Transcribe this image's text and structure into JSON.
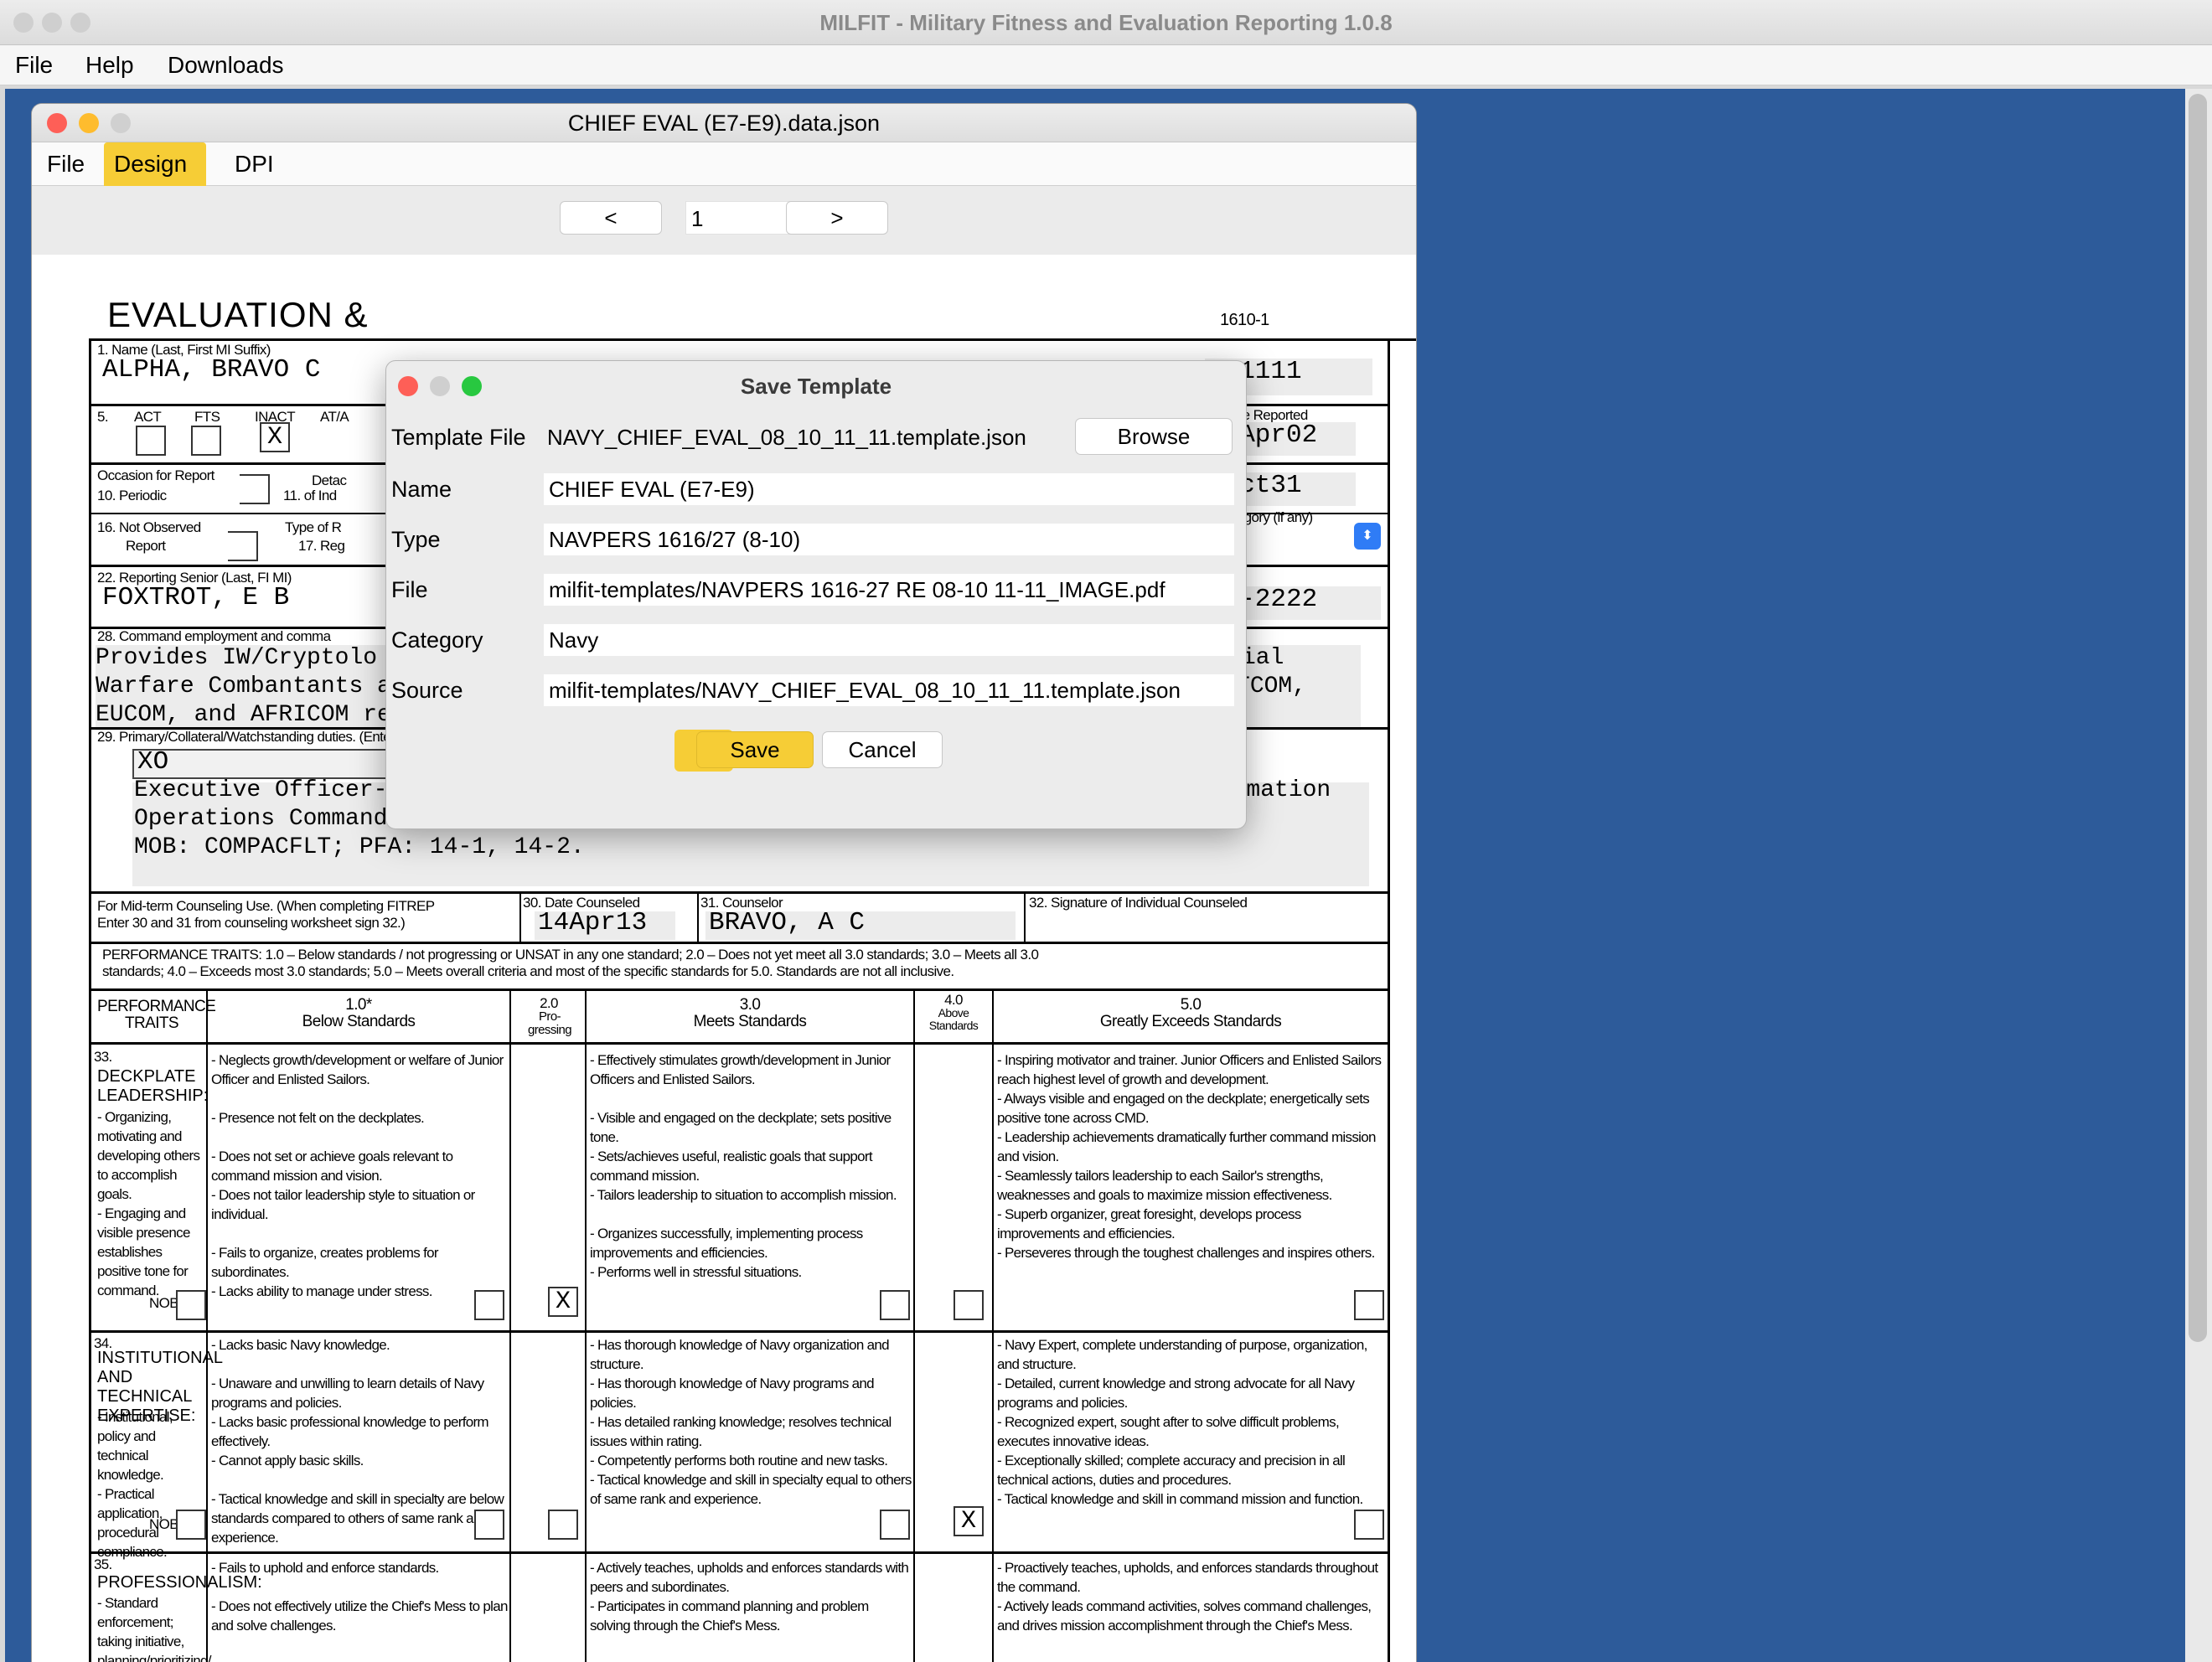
{
  "app": {
    "title": "MILFIT - Military Fitness and Evaluation Reporting 1.0.8",
    "menu": [
      "File",
      "Help",
      "Downloads"
    ]
  },
  "doc": {
    "title": "CHIEF EVAL (E7-E9).data.json",
    "menu": [
      "File",
      "Design",
      "DPI"
    ],
    "prev_label": "<",
    "next_label": ">",
    "page_number": "1"
  },
  "form": {
    "heading": "EVALUATION &",
    "form_number": "1610-1",
    "labels": {
      "name": "1. Name      (Last, First MI Suffix)",
      "block5": "5.",
      "act": "ACT",
      "fts": "FTS",
      "inact": "INACT",
      "atadsw": "AT/A",
      "date_reported": "Date Reported",
      "occasion": "Occasion for Report",
      "periodic": "10. Periodic",
      "detach": "Detac",
      "detach2": "11.  of Ind",
      "not_observed": "16. Not Observed",
      "report": "Report",
      "type_of": "Type of R",
      "regular": "17.  Reg",
      "subcategory": "bcategory (if any)",
      "reporting_senior": "22. Reporting Senior  (Last, FI MI)",
      "command_employment": "28. Command employment and comma",
      "duties": "29. Primary/Collateral/Watchstanding duties.  (Enter Primary duty abbreviation in box.)",
      "midterm": "For Mid-term Counseling Use.  (When completing FITREP",
      "midterm2": "Enter 30 and 31 from counseling worksheet sign 32.)",
      "date_counseled": "30.  Date Counseled",
      "counselor": "31.  Counselor",
      "signature": "32.  Signature of Individual Counseled",
      "perf_note1": "PERFORMANCE TRAITS:  1.0 – Below standards / not progressing or UNSAT in any one standard;   2.0 – Does not yet meet all 3.0 standards;   3.0 – Meets all 3.0",
      "perf_note2": "standards;   4.0 – Exceeds most 3.0 standards;   5.0 – Meets overall criteria and most of the specific standards for 5.0.  Standards are not all inclusive."
    },
    "values": {
      "name": "ALPHA, BRAVO C",
      "ssn": "1-1111",
      "inact_mark": "X",
      "date_reported": "14Apr02",
      "to_date": "40ct31",
      "reporting_senior": "FOXTROT, E B",
      "rs_ssn": "22-2222",
      "command_line1": "Provides IW/Cryptolo",
      "command_line1_end": "ial",
      "command_line2": "Warfare Combantants and AAA/BBB Georgia. Reach back/extended staff support to CENTCOM,",
      "command_line3": "EUCOM, and AFRICOM requirements.",
      "duty_abbrev": "XO",
      "duties_line1": "Executive Officer-8; Lead administration and operations of 29-Sailor Navy Information",
      "duties_line2": "Operations Command.",
      "duties_line3": "MOB: COMPACFLT; PFA: 14-1, 14-2.",
      "date_counseled": "14Apr13",
      "counselor": "BRAVO, A C"
    },
    "headers": {
      "traits": "PERFORMANCE TRAITS",
      "h1": "1.0*",
      "h1b": "Below Standards",
      "h2": "2.0",
      "h2b": "Pro-gressing",
      "h3": "3.0",
      "h3b": "Meets Standards",
      "h4": "4.0",
      "h4b": "Above Standards",
      "h5": "5.0",
      "h5b": "Greatly Exceeds Standards"
    },
    "traits": [
      {
        "num": "33.",
        "name": "DECKPLATE LEADERSHIP:",
        "desc": "- Organizing, motivating and developing others to accomplish goals.\n- Engaging and visible presence establishes positive tone for command.",
        "nob": "NOB",
        "below": "- Neglects growth/development or welfare of Junior Officer and Enlisted Sailors.\n\n- Presence not felt on the deckplates.\n\n- Does not set or achieve goals relevant to command mission and vision.\n- Does not tailor leadership style to situation or individual.\n\n- Fails to organize, creates problems for subordinates.\n- Lacks ability to manage under stress.",
        "meets": "- Effectively stimulates growth/development in Junior Officers and Enlisted Sailors.\n\n- Visible and engaged on the deckplate; sets positive tone.\n- Sets/achieves useful, realistic goals that support command mission.\n- Tailors leadership to situation to accomplish mission.\n\n- Organizes successfully, implementing process improvements and efficiencies.\n- Performs well in stressful situations.",
        "greatly": "- Inspiring motivator and trainer.  Junior Officers and Enlisted Sailors reach highest level of growth and development.\n- Always visible and engaged on the deckplate; energetically sets positive tone across CMD.\n- Leadership achievements dramatically further command mission and vision.\n- Seamlessly tailors leadership to each Sailor's strengths, weaknesses and goals to maximize mission effectiveness.\n- Superb organizer, great foresight, develops process improvements and efficiencies.\n- Perseveres through the toughest challenges and inspires others.",
        "marks": [
          "",
          "",
          "X",
          "",
          "",
          ""
        ]
      },
      {
        "num": "34.",
        "name": "INSTITUTIONAL AND TECHNICAL EXPERTISE:",
        "desc": "- Institutional, policy and technical knowledge.\n- Practical application, procedural compliance.",
        "nob": "NOB",
        "below": "- Lacks basic Navy knowledge.\n\n- Unaware and unwilling to learn details of Navy programs and policies.\n- Lacks basic professional knowledge to perform effectively.\n- Cannot apply basic skills.\n\n- Tactical knowledge and skill in specialty are below standards compared to others of same rank and experience.",
        "meets": "- Has thorough knowledge of Navy organization and structure.\n- Has thorough knowledge of Navy programs and policies.\n- Has detailed ranking knowledge; resolves technical issues within rating.\n- Competently performs both routine and new tasks.\n- Tactical knowledge and skill in specialty equal to others of same rank and experience.",
        "greatly": "- Navy Expert, complete understanding of purpose, organization, and structure.\n- Detailed, current knowledge and strong advocate for all Navy programs and policies.\n- Recognized expert, sought after to solve difficult problems, executes innovative ideas.\n- Exceptionally skilled; complete accuracy and precision in all technical actions, duties and procedures.\n- Tactical knowledge and skill in command mission and function.",
        "marks": [
          "",
          "",
          "",
          "",
          "X",
          ""
        ]
      },
      {
        "num": "35.",
        "name": "PROFESSIONALISM:",
        "desc": "- Standard enforcement; taking initiative, planning/prioritizing/",
        "below": "- Fails to uphold and enforce standards.\n\n- Does not effectively utilize the Chief's Mess to plan and solve challenges.",
        "meets": "- Actively teaches, upholds and enforces standards with peers and subordinates.\n- Participates in command planning and problem solving through the Chief's Mess.",
        "greatly": "- Proactively teaches, upholds, and enforces standards throughout the command.\n- Actively leads command activities, solves command challenges, and drives mission accomplishment through the Chief's Mess."
      }
    ]
  },
  "dialog": {
    "title": "Save Template",
    "template_file_label": "Template File",
    "template_file_value": "NAVY_CHIEF_EVAL_08_10_11_11.template.json",
    "browse_label": "Browse",
    "name_label": "Name",
    "name_value": "CHIEF EVAL (E7-E9)",
    "type_label": "Type",
    "type_value": "NAVPERS 1616/27 (8-10)",
    "file_label": "File",
    "file_value": "milfit-templates/NAVPERS 1616-27 RE 08-10 11-11_IMAGE.pdf",
    "category_label": "Category",
    "category_value": "Navy",
    "source_label": "Source",
    "source_value": "milfit-templates/NAVY_CHIEF_EVAL_08_10_11_11.template.json",
    "save_label": "Save",
    "cancel_label": "Cancel"
  },
  "colors": {
    "desktop": "#2d5b9a",
    "highlight": "#f6cd36",
    "close": "#fe5f57",
    "minimize": "#febc2e",
    "zoom": "#28c840"
  }
}
